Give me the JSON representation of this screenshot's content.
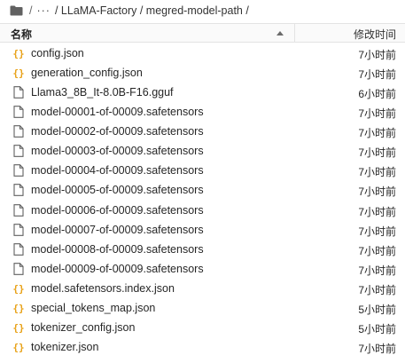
{
  "breadcrumb": {
    "root_sep": "/",
    "ellipsis": "···",
    "path": "/ LLaMA-Factory / megred-model-path /"
  },
  "header": {
    "name_label": "名称",
    "modified_label": "修改时间",
    "sort": "ascending"
  },
  "files": [
    {
      "name": "config.json",
      "time": "7小时前",
      "type": "json"
    },
    {
      "name": "generation_config.json",
      "time": "7小时前",
      "type": "json"
    },
    {
      "name": "Llama3_8B_It-8.0B-F16.gguf",
      "time": "6小时前",
      "type": "file"
    },
    {
      "name": "model-00001-of-00009.safetensors",
      "time": "7小时前",
      "type": "file"
    },
    {
      "name": "model-00002-of-00009.safetensors",
      "time": "7小时前",
      "type": "file"
    },
    {
      "name": "model-00003-of-00009.safetensors",
      "time": "7小时前",
      "type": "file"
    },
    {
      "name": "model-00004-of-00009.safetensors",
      "time": "7小时前",
      "type": "file"
    },
    {
      "name": "model-00005-of-00009.safetensors",
      "time": "7小时前",
      "type": "file"
    },
    {
      "name": "model-00006-of-00009.safetensors",
      "time": "7小时前",
      "type": "file"
    },
    {
      "name": "model-00007-of-00009.safetensors",
      "time": "7小时前",
      "type": "file"
    },
    {
      "name": "model-00008-of-00009.safetensors",
      "time": "7小时前",
      "type": "file"
    },
    {
      "name": "model-00009-of-00009.safetensors",
      "time": "7小时前",
      "type": "file"
    },
    {
      "name": "model.safetensors.index.json",
      "time": "7小时前",
      "type": "json"
    },
    {
      "name": "special_tokens_map.json",
      "time": "5小时前",
      "type": "json"
    },
    {
      "name": "tokenizer_config.json",
      "time": "5小时前",
      "type": "json"
    },
    {
      "name": "tokenizer.json",
      "time": "7小时前",
      "type": "json"
    }
  ],
  "icons": {
    "folder": "folder-icon",
    "json": "json-file-icon",
    "file": "file-icon"
  },
  "colors": {
    "json_icon": "#e8a117",
    "file_icon": "#616161",
    "header_bg": "#fafafa"
  }
}
